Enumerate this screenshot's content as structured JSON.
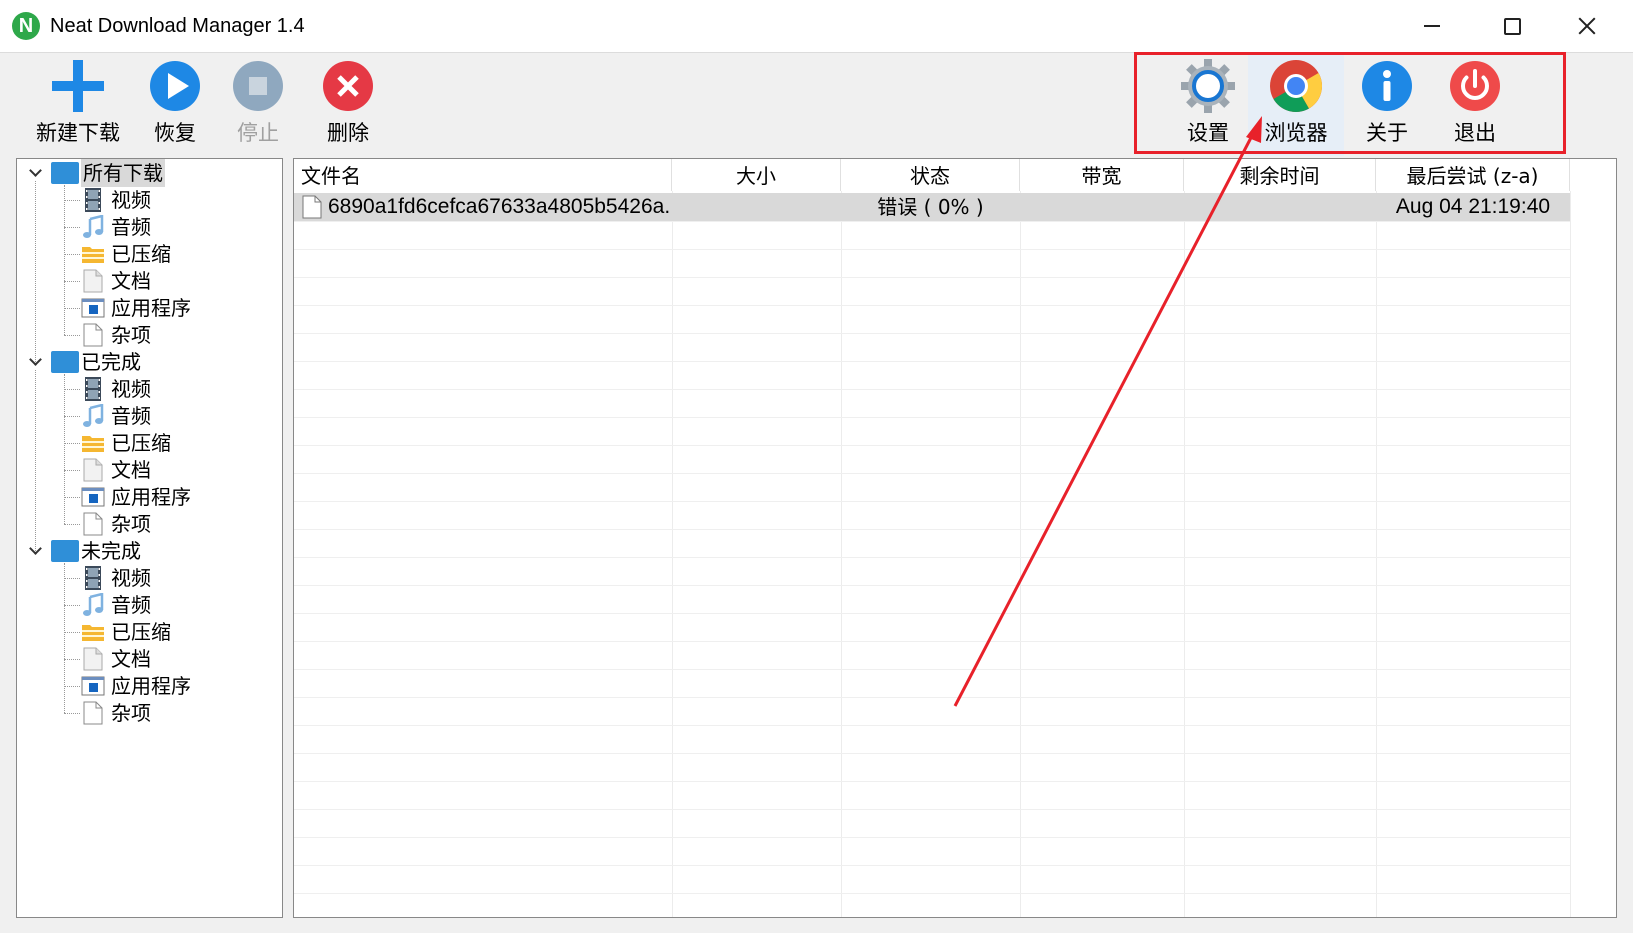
{
  "window": {
    "title": "Neat Download Manager 1.4",
    "app_icon_letter": "N",
    "controls": {
      "minimize": "minimize",
      "maximize": "maximize",
      "close": "close"
    }
  },
  "toolbar": {
    "new_download": "新建下载",
    "resume": "恢复",
    "stop": "停止",
    "delete": "删除",
    "settings": "设置",
    "browser": "浏览器",
    "about": "关于",
    "exit": "退出"
  },
  "tree": {
    "groups": [
      {
        "label": "所有下载",
        "items": [
          "视频",
          "音频",
          "已压缩",
          "文档",
          "应用程序",
          "杂项"
        ]
      },
      {
        "label": "已完成",
        "items": [
          "视频",
          "音频",
          "已压缩",
          "文档",
          "应用程序",
          "杂项"
        ]
      },
      {
        "label": "未完成",
        "items": [
          "视频",
          "音频",
          "已压缩",
          "文档",
          "应用程序",
          "杂项"
        ]
      }
    ]
  },
  "list": {
    "columns": [
      "文件名",
      "大小",
      "状态",
      "带宽",
      "剩余时间",
      "最后尝试 (z-a)"
    ],
    "rows": [
      {
        "name": "6890a1fd6cefca67633a4805b5426a...",
        "size": "",
        "status": "错误 ( 0% )",
        "bandwidth": "",
        "remaining": "",
        "last_try": "Aug 04 21:19:40"
      }
    ]
  },
  "colors": {
    "accent_highlight": "#e8212a",
    "folder": "#2f8fd8",
    "resume_blue": "#1e88e5",
    "delete_red": "#e53945",
    "about_blue": "#1e88e5",
    "exit_red": "#ef4a4a"
  }
}
